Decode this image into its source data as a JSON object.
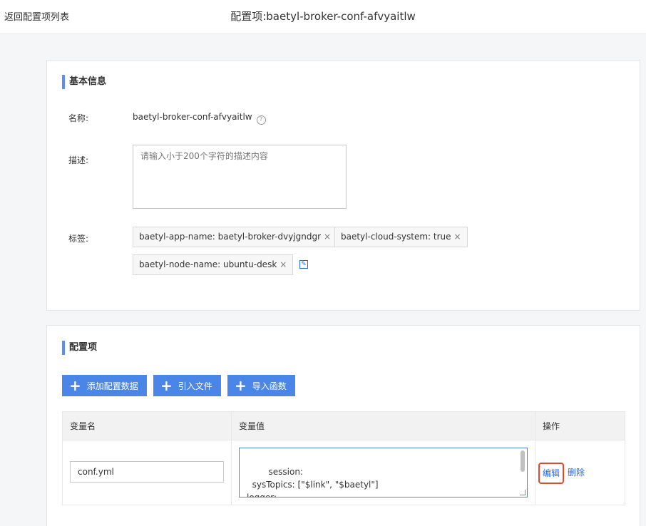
{
  "header": {
    "back_label": "返回配置项列表",
    "title": "配置项:baetyl-broker-conf-afvyaitlw"
  },
  "basic_info": {
    "section_title": "基本信息",
    "name_label": "名称:",
    "name_value": "baetyl-broker-conf-afvyaitlw",
    "help_icon": "question-circle-icon",
    "desc_label": "描述:",
    "desc_placeholder": "请输入小于200个字符的描述内容",
    "tags_label": "标签:",
    "tags": [
      "baetyl-app-name: baetyl-broker-dvyjgndgr",
      "baetyl-cloud-system: true",
      "baetyl-node-name: ubuntu-desk"
    ],
    "tag_remove_icon": "close-icon",
    "tag_edit_icon": "edit-icon"
  },
  "config_items": {
    "section_title": "配置项",
    "buttons": {
      "add_data": "添加配置数据",
      "import_file": "引入文件",
      "import_function": "导入函数"
    },
    "columns": [
      "变量名",
      "变量值",
      "操作"
    ],
    "rows": [
      {
        "name": "conf.yml",
        "value": "session:\n  sysTopics: [\"$link\", \"$baetyl\"]\nlogger:\n  level: debug",
        "actions": {
          "edit": "编辑",
          "delete": "删除"
        }
      }
    ]
  },
  "colors": {
    "accent": "#4a86e8",
    "link": "#2468f2",
    "highlight_border": "#e0492b"
  }
}
